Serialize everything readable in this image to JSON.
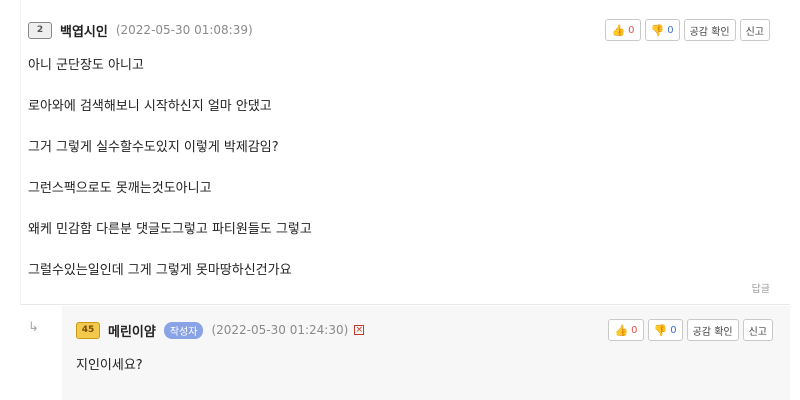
{
  "comment": {
    "nickname": "백엽시인",
    "level_icon": "level-2-icon",
    "level_text": "2",
    "date": "(2022-05-30 01:08:39)",
    "buttons": {
      "like_count": "0",
      "dislike_count": "0",
      "empathy": "공감 확인",
      "report": "신고"
    },
    "lines": [
      "아니 군단장도 아니고",
      "로아와에 검색해보니 시작하신지 얼마 안댔고",
      "그거 그렇게 실수할수도있지 이렇게 박제감임?",
      "그런스팩으로도 못깨는것도아니고",
      "왜케 민감함 다른분 댓글도그렇고 파티원들도 그렇고",
      "그럴수있는일인데 그게 그렇게 못마땅하신건가요"
    ],
    "reply_link": "답글"
  },
  "reply": {
    "nickname": "메린이얌",
    "level_icon": "level-45-icon",
    "level_text": "45",
    "author_badge": "작성자",
    "date": "(2022-05-30 01:24:30)",
    "buttons": {
      "like_count": "0",
      "dislike_count": "0",
      "empathy": "공감 확인",
      "report": "신고"
    },
    "text": "지인이세요?"
  }
}
